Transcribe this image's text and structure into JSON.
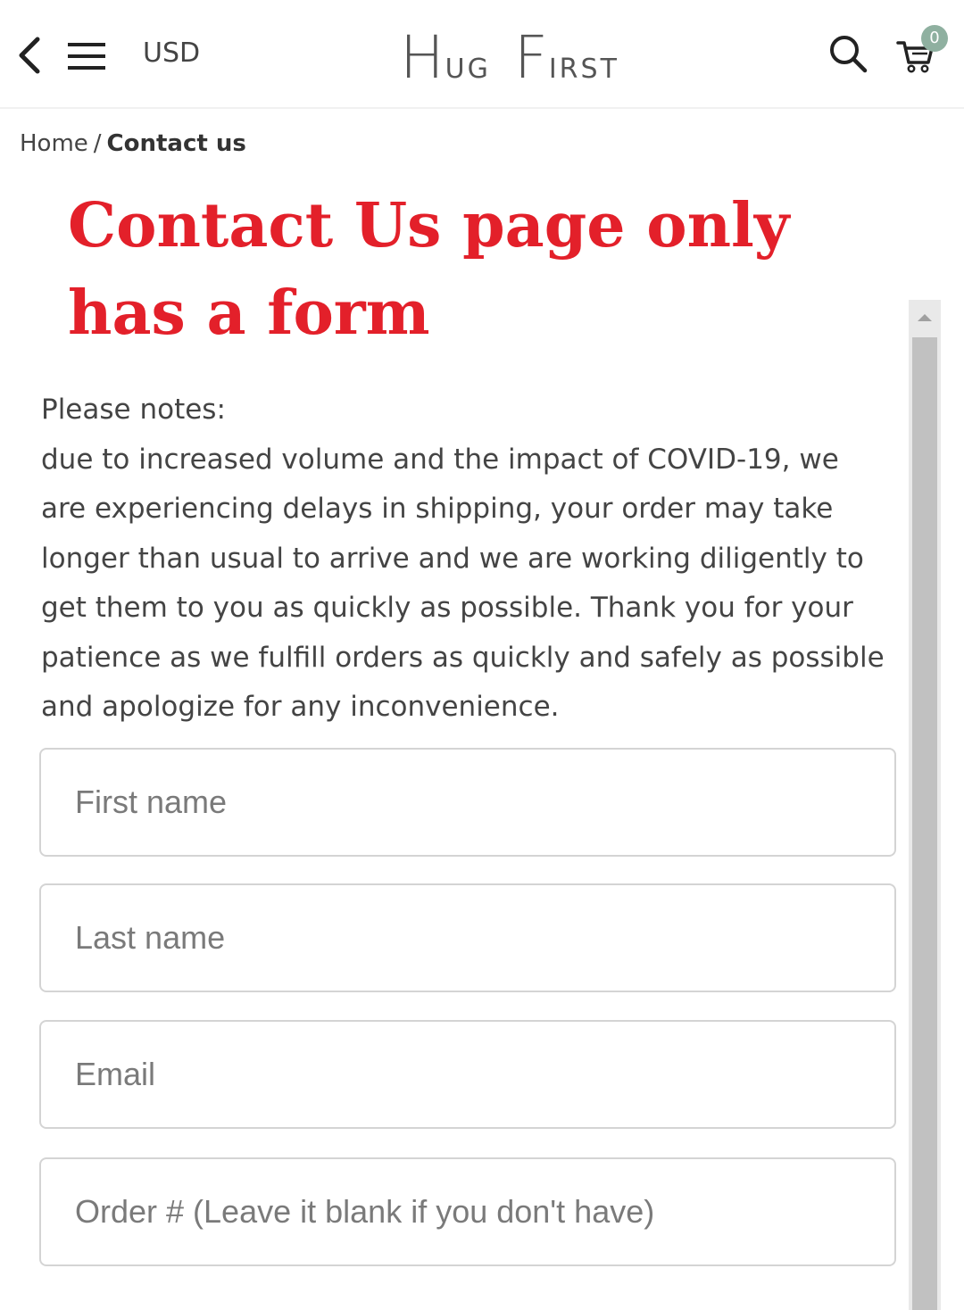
{
  "header": {
    "currency": "USD",
    "logo": {
      "word1_initial": "H",
      "word1_rest": "UG",
      "word2_initial": "F",
      "word2_rest": "IRST"
    },
    "cart_count": "0",
    "icons": [
      "back-icon",
      "menu-icon",
      "search-icon",
      "cart-icon"
    ]
  },
  "breadcrumb": {
    "home": "Home",
    "separator": "/",
    "current": "Contact us"
  },
  "annotation": {
    "text": "Contact Us page only has a form",
    "color": "#e3202a"
  },
  "notes": {
    "heading": "Please notes:",
    "body": "due to increased volume and the impact of COVID-19, we are experiencing delays in shipping, your order may take longer than usual to arrive and we are working diligently to get them to you as quickly as possible. Thank you for your patience as we fulfill orders as quickly and safely as possible and apologize for any inconvenience."
  },
  "form": {
    "first_name": {
      "placeholder": "First name",
      "value": ""
    },
    "last_name": {
      "placeholder": "Last name",
      "value": ""
    },
    "email": {
      "placeholder": "Email",
      "value": ""
    },
    "order_number": {
      "placeholder": "Order # (Leave it blank if you don't have)",
      "value": ""
    }
  },
  "colors": {
    "badge": "#8fb0a0",
    "text": "#444444",
    "field_border": "#d4d4d4"
  }
}
